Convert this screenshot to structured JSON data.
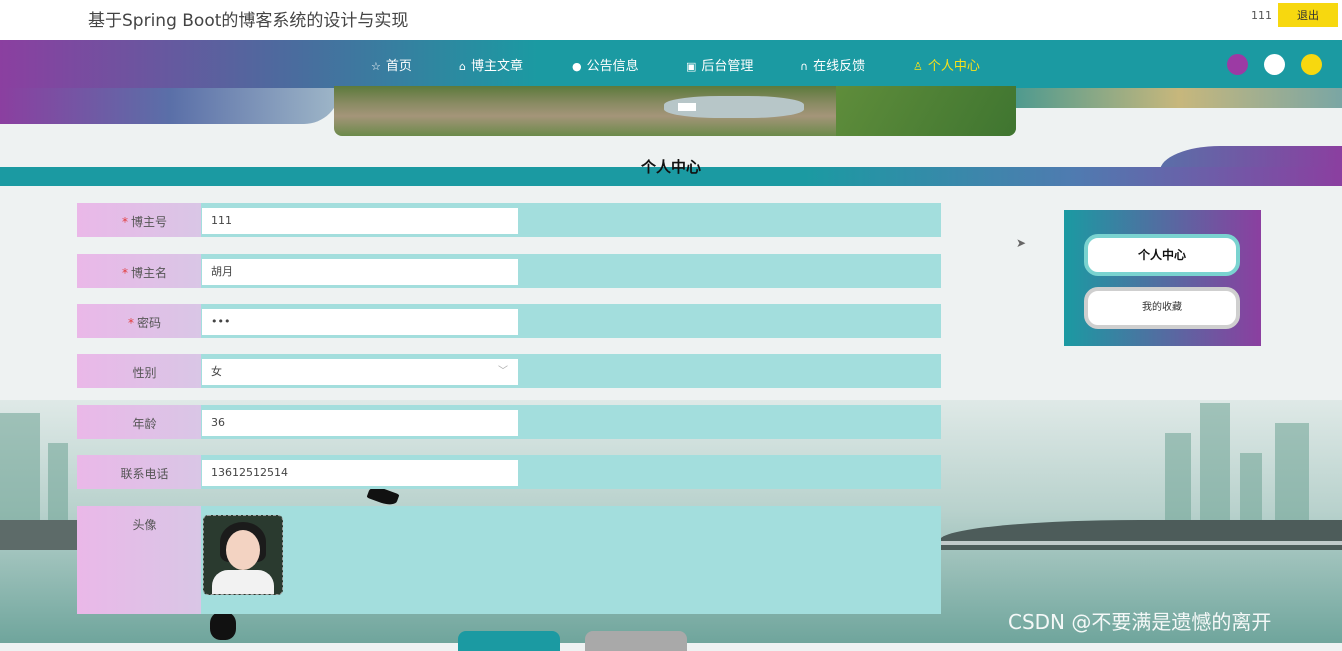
{
  "site": {
    "title": "基于Spring Boot的博客系统的设计与实现",
    "username": "111",
    "logout_label": "退出"
  },
  "nav": {
    "items": [
      {
        "label": "首页",
        "icon": "star-icon"
      },
      {
        "label": "博主文章",
        "icon": "home-icon"
      },
      {
        "label": "公告信息",
        "icon": "clock-icon"
      },
      {
        "label": "后台管理",
        "icon": "gift-icon"
      },
      {
        "label": "在线反馈",
        "icon": "headset-icon"
      },
      {
        "label": "个人中心",
        "icon": "user-icon",
        "active": true
      }
    ],
    "theme_colors": [
      "#9c3aa4",
      "#ffffff",
      "#f7d80f"
    ]
  },
  "page": {
    "title": "个人中心"
  },
  "form": {
    "blogger_no": {
      "label": "博主号",
      "required": true,
      "value": "111"
    },
    "blogger_name": {
      "label": "博主名",
      "required": true,
      "value": "胡月"
    },
    "password": {
      "label": "密码",
      "required": true,
      "value": "•••"
    },
    "gender": {
      "label": "性别",
      "value": "女"
    },
    "age": {
      "label": "年龄",
      "value": "36"
    },
    "phone": {
      "label": "联系电话",
      "value": "13612512514"
    },
    "avatar": {
      "label": "头像"
    },
    "required_mark": "*"
  },
  "sidebar": {
    "items": [
      {
        "label": "个人中心",
        "active": true
      },
      {
        "label": "我的收藏"
      }
    ]
  },
  "watermark": "CSDN @不要满是遗憾的离开",
  "colors": {
    "accent": "#1b9aa2",
    "purple": "#8b3fa0",
    "logout": "#f7d80f",
    "form_bg": "#a3dedd"
  }
}
